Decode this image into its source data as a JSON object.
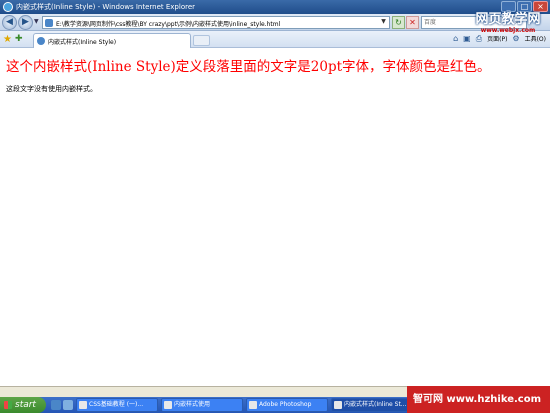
{
  "window": {
    "title": "内嵌式样式(Inline Style) - Windows Internet Explorer",
    "min": "_",
    "max": "□",
    "close": "×"
  },
  "address_bar": {
    "url": "E:\\教学资源\\网页制作\\css教程\\BY crazy\\ppt\\示例\\内嵌样式使用\\inline_style.html",
    "search_placeholder": "百度"
  },
  "tab": {
    "label": "内嵌式样式(Inline Style)"
  },
  "toolbar": {
    "page_label": "页面(P)",
    "tools_label": "工具(O)"
  },
  "content": {
    "red_paragraph": "这个内嵌样式(Inline Style)定义段落里面的文字是20pt字体，字体颜色是红色。",
    "plain_paragraph": "这段文字没有使用内嵌样式。"
  },
  "taskbar": {
    "start": "start",
    "tasks": [
      "CSS基础教程 (一)...",
      "内嵌样式使用",
      "Adobe Photoshop",
      "内嵌式样式(Inline St..."
    ]
  },
  "watermarks": {
    "top_main": "网页教学网",
    "top_url": "www.webjx.com",
    "bottom": "智可网 www.hzhike.com"
  },
  "colors": {
    "accent_red": "#ff0000",
    "title_blue": "#1f4d8a"
  }
}
